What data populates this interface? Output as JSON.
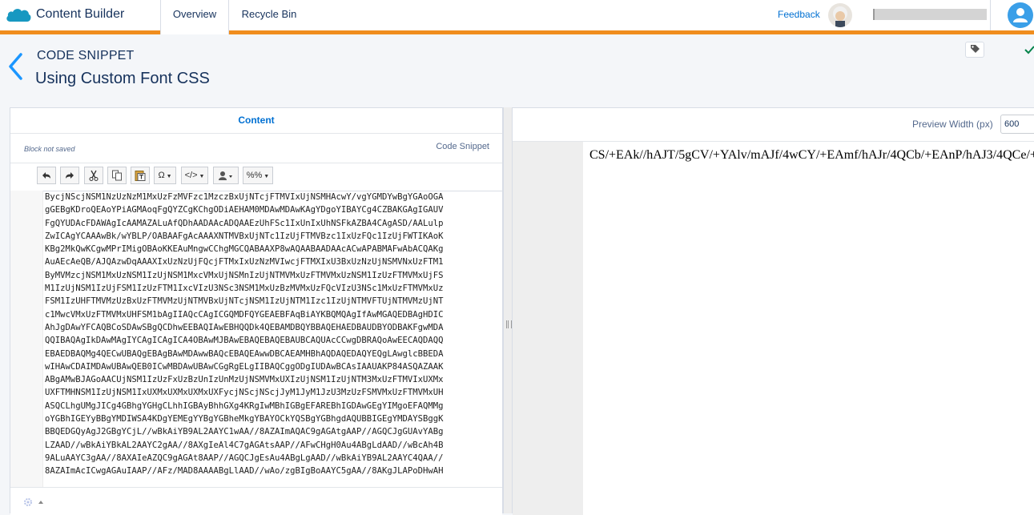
{
  "app": {
    "title": "Content Builder",
    "tabs": [
      {
        "label": "Overview",
        "active": true
      },
      {
        "label": "Recycle Bin",
        "active": false
      }
    ],
    "feedback_label": "Feedback",
    "accent_color": "#f08d1e"
  },
  "header": {
    "type_label": "CODE SNIPPET",
    "name": "Using Custom Font CSS"
  },
  "editor": {
    "tab_label": "Content",
    "status": "Block not saved",
    "block_type": "Code Snippet",
    "toolbar": {
      "undo_icon": "undo-icon",
      "redo_icon": "redo-icon",
      "cut_icon": "cut-icon",
      "copy_icon": "copy-icon",
      "paste_text_icon": "paste-text-icon",
      "special_char_label": "Ω",
      "source_label": "</>",
      "personalization_icon": "user-icon",
      "ampscript_label": "%%"
    },
    "code_lines": [
      "BycjNScjNSM1NzUzNzM1MxUzFzMVFzc1MzczBxUjNTcjFTMVIxUjNSMHAcwY/vgYGMDYwBgYGAoOGA",
      "gGEBgKDroQEAoYPiAGMAoqFgQYZCgKChgODiAEHAM0MDAwMDAwKAgYDgoYIBAYCg4CZBAKGAgIGAUV",
      "FgQYUDAcFDAWAgIcAAMAZALuAfQDhAADAAcADQAAEzUhFSc1IxUnIxUhNSFkAZBA4CAgASD/AALulp",
      "ZwICAgYCAAAwBk/wYBLP/OABAAFgAcAAAXNTMVBxUjNTc1IzUjFTMVBzc1IxUzFQc1IzUjFWTIKAoK",
      "KBg2MkQwKCgwMPrIMigOBAoKKEAuMngwCChgMGCQABAAXP8wAQAABAADAAcACwAPABMAFwAbACQAKg",
      "AuAEcAeQB/AJQAzwDqAAAXIxUzNzUjFQcjFTMxIxUzNzMVIwcjFTMXIxU3BxUzNzUjNSMVNxUzFTM1",
      "ByMVMzcjNSM1MxUzNSM1IzUjNSM1MxcVMxUjNSMnIzUjNTMVMxUzFTMVMxUzNSM1IzUzFTMVMxUjFS",
      "M1IzUjNSM1IzUjFSM1IzUzFTM1IxcVIzU3NSc3NSM1MxUzBzMVMxUzFQcVIzU3NSc1MxUzFTMVMxUz",
      "FSM1IzUHFTMVMzUzBxUzFTMVMzUjNTMVBxUjNTcjNSM1IzUjNTM1Izc1IzUjNTMVFTUjNTMVMzUjNT",
      "c1MwcVMxUzFTMVMxUHFSM1bAgIIAQcCAgICGQMDFQYGEAEBFAqBiAYKBQMQAgIfAwMGAQEDBAgHDIC",
      "AhJgDAwYFCAQBCoSDAwSBgQCDhwEEBAQIAwEBHQQDk4QEBAMDBQYBBAQEHAEDBAUDBYODBAKFgwMDA",
      "QQIBAQAgIkDAwMAgIYCAgICAgICA4OBAwMJBAwEBAQEBAQEBAUBCAQUAcCCwgDBRAQoAwEECAQDAQQ",
      "EBAEDBAQMg4QECwUBAQgEBAgBAwMDAwwBAQcEBAQEAwwDBCAEAMHBhAQDAQEDAQYEQgLAwglcBBEDA",
      "wIHAwCDAIMDAwUBAwQEB0ICwMBDAwUBAwCGgRgELgIIBAQCggODgIUDAwBCAsIAAUAKP84ASQAZAAK",
      "ABgAMwBJAGoAACUjNSM1IzUzFxUzBzUnIzUnMzUjNSMVMxUXIzUjNSM1IzUjNTM3MxUzFTMVIxUXMx",
      "UXFTMHNSM1IzUjNSM1IxUXMxUXMxUXMxUXFycjNScjNScjJyM1JyM1JzU3MzUzFSMVMxUzFTMVMxUH",
      "ASQCLhgUMgJICg4GBhgYGHgCLhhIGBAyBhhGXg4KRgIwMBhIGBgEFAREBhIGDAwGEgYIMgoEFAQMMg",
      "oYGBhIGEYyBBgYMDIWSA4KDgYEMEgYYBgYGBheMkgYBAYOCkYQSBgYGBhgdAQUBBIGEgYMDAYSBggK",
      "BBQEDGQyAgJ2GBgYCjL//wBkAiYB9AL2AAYC1wAA//8AZAImAQAC9gAGAtgAAP//AGQCJgGUAvYABg",
      "LZAAD//wBkAiYBkAL2AAYC2gAA//8AXgIeAl4C7gAGAtsAAP//AFwCHgH0Au4ABgLdAAD//wBcAh4B",
      "9ALuAAYC3gAA//8AXAIeAZQC9gAGAt8AAP//AGQCJgEsAu4ABgLgAAD//wBkAiYB9AL2AAYC4QAA//",
      "8AZAImAcICwgAGAuIAAP//AFz/MAD8AAAABgLlAAD//wAo/zgBIgBoAAYC5gAA//8AKgJLAPoDHwAH"
    ]
  },
  "preview": {
    "width_label": "Preview Width (px)",
    "width_value": "600",
    "text": "CS/+EAk//hAJT/5gCV/+YAlv/mAJf/4wCY/+EAmf/hAJr/4QCb/+EAnP/hAJ3/4QCe/+"
  }
}
